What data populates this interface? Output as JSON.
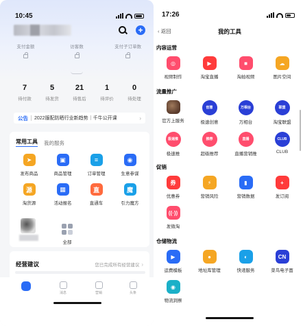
{
  "left": {
    "status_time": "10:45",
    "metrics": [
      {
        "label": "支付金额"
      },
      {
        "label": "访客数"
      },
      {
        "label": "支付子订单数"
      }
    ],
    "stats": [
      {
        "num": "7",
        "label": "待付款"
      },
      {
        "num": "5",
        "label": "待发货"
      },
      {
        "num": "21",
        "label": "待售后"
      },
      {
        "num": "1",
        "label": "待评价"
      },
      {
        "num": "0",
        "label": "待处理"
      }
    ],
    "notice": {
      "tag": "公告",
      "text": "2022服配防晒行业新趋势｜千牛公开课",
      "arrow": "›"
    },
    "tools": {
      "tab_active": "常用工具",
      "tab_other": "我的服务",
      "items": [
        {
          "label": "发布商品",
          "icon": "paper-plane-icon",
          "color": "#f5a623",
          "glyph": "➤"
        },
        {
          "label": "商品管理",
          "icon": "bag-icon",
          "color": "#2a6cf6",
          "glyph": "▣"
        },
        {
          "label": "订单管理",
          "icon": "order-icon",
          "color": "#1aa0e8",
          "glyph": "≡"
        },
        {
          "label": "生意参谋",
          "icon": "compass-icon",
          "color": "#2a6cf6",
          "glyph": "◉"
        },
        {
          "label": "淘货源",
          "icon": "source-icon",
          "color": "#f5a623",
          "glyph": "源"
        },
        {
          "label": "活动报名",
          "icon": "calendar-icon",
          "color": "#2a6cf6",
          "glyph": "▦"
        },
        {
          "label": "直通车",
          "icon": "car-icon",
          "color": "#ff6a3d",
          "glyph": "直"
        },
        {
          "label": "引力魔方",
          "icon": "cube-icon",
          "color": "#1aa0e8",
          "glyph": "魔"
        }
      ],
      "all_label": "全部"
    },
    "biz": {
      "title": "经营建议",
      "sub": "您已完成所有经营建议",
      "arrow": "›"
    },
    "tabbar": [
      "首页",
      "消息",
      "营销",
      "头条"
    ]
  },
  "right": {
    "status_time": "17:26",
    "back_label": "返回",
    "title": "我的工具",
    "sections": [
      {
        "title": "内容运营",
        "items": [
          {
            "label": "视频制作",
            "icon": "video-make-icon",
            "color": "#ff4d6d",
            "glyph": "◎",
            "shape": "square"
          },
          {
            "label": "淘宝直播",
            "icon": "live-icon",
            "color": "#ff3b3b",
            "glyph": "▶",
            "shape": "square"
          },
          {
            "label": "淘拍视频",
            "icon": "camera-icon",
            "color": "#ff4d6d",
            "glyph": "■",
            "shape": "square"
          },
          {
            "label": "图片空间",
            "icon": "cloud-icon",
            "color": "#f5a623",
            "glyph": "☁",
            "shape": "square"
          }
        ]
      },
      {
        "title": "流量推广",
        "items": [
          {
            "label": "官方上服务",
            "icon": "official-photo-icon",
            "color": "#6b4a3a",
            "glyph": "",
            "shape": "square"
          },
          {
            "label": "极速创意",
            "icon": "speed-creative-icon",
            "color": "#2a3fd6",
            "glyph": "创意",
            "shape": "circle"
          },
          {
            "label": "万相台",
            "icon": "wanxiangtai-icon",
            "color": "#2a3fd6",
            "glyph": "万相台",
            "shape": "circle"
          },
          {
            "label": "淘宝联盟",
            "icon": "alliance-icon",
            "color": "#2a3fd6",
            "glyph": "联盟",
            "shape": "circle"
          },
          {
            "label": "极速推",
            "icon": "fast-push-icon",
            "color": "#ff4d6d",
            "glyph": "极速推",
            "shape": "circle"
          },
          {
            "label": "超级推荐",
            "icon": "super-recommend-icon",
            "color": "#ff4d6d",
            "glyph": "推荐",
            "shape": "circle"
          },
          {
            "label": "直播营销推",
            "icon": "live-push-icon",
            "color": "#ff4d6d",
            "glyph": "直播",
            "shape": "circle"
          },
          {
            "label": "CLUB",
            "icon": "club-icon",
            "color": "#2a3fd6",
            "glyph": "CLUB",
            "shape": "circle"
          }
        ]
      },
      {
        "title": "促销",
        "items": [
          {
            "label": "优惠券",
            "icon": "coupon-icon",
            "color": "#ff3b3b",
            "glyph": "券",
            "shape": "square"
          },
          {
            "label": "营销风险",
            "icon": "shield-icon",
            "color": "#f5a623",
            "glyph": "⚡",
            "shape": "square"
          },
          {
            "label": "营销数据",
            "icon": "data-icon",
            "color": "#2a6cf6",
            "glyph": "▮",
            "shape": "square"
          },
          {
            "label": "发订阅",
            "icon": "subscribe-icon",
            "color": "#ff3b3b",
            "glyph": "+",
            "shape": "square"
          },
          {
            "label": "发微淘",
            "icon": "weitao-icon",
            "color": "#ff4d6d",
            "glyph": "((·))",
            "shape": "square"
          }
        ]
      },
      {
        "title": "仓储物流",
        "items": [
          {
            "label": "运费模板",
            "icon": "truck-icon",
            "color": "#2a6cf6",
            "glyph": "▶",
            "shape": "square"
          },
          {
            "label": "地址库管理",
            "icon": "location-icon",
            "color": "#f5a623",
            "glyph": "●",
            "shape": "square"
          },
          {
            "label": "快递服务",
            "icon": "express-icon",
            "color": "#1aa0e8",
            "glyph": "◐",
            "shape": "square"
          },
          {
            "label": "菜鸟电子面",
            "icon": "cainiao-icon",
            "color": "#2a3fd6",
            "glyph": "CN",
            "shape": "square"
          },
          {
            "label": "物流洞察",
            "icon": "insight-icon",
            "color": "#1ab0c8",
            "glyph": "◉",
            "shape": "square"
          }
        ]
      }
    ]
  }
}
